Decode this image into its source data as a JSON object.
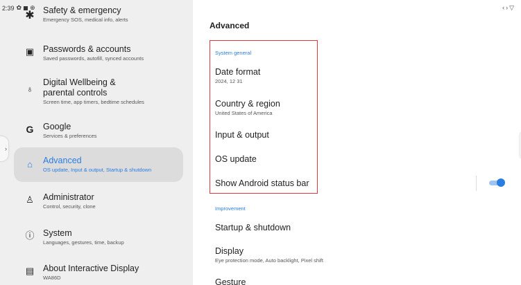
{
  "status_bar": {
    "time": "2:39"
  },
  "left_menu": {
    "items": [
      {
        "id": "safety",
        "icon": "asterisk-icon",
        "glyph": "✱",
        "title": "Safety & emergency",
        "subtitle": "Emergency SOS, medical info, alerts"
      },
      {
        "id": "passwords",
        "icon": "account-box-icon",
        "glyph": "▣",
        "title": "Passwords & accounts",
        "subtitle": "Saved passwords, autofill, synced accounts"
      },
      {
        "id": "wellbeing",
        "icon": "wellbeing-icon",
        "glyph": "♁",
        "title": "Digital Wellbeing & parental controls",
        "subtitle": "Screen time, app timers, bedtime schedules"
      },
      {
        "id": "google",
        "icon": "google-icon",
        "glyph": "G",
        "title": "Google",
        "subtitle": "Services & preferences"
      },
      {
        "id": "advanced",
        "icon": "advanced-icon",
        "glyph": "⌂",
        "title": "Advanced",
        "subtitle": "OS update, Input & output, Startup & shutdown"
      },
      {
        "id": "administrator",
        "icon": "admin-person-icon",
        "glyph": "♙",
        "title": "Administrator",
        "subtitle": "Control, security, clone"
      },
      {
        "id": "system",
        "icon": "info-icon",
        "glyph": "ⓘ",
        "title": "System",
        "subtitle": "Languages, gestures, time, backup"
      },
      {
        "id": "about",
        "icon": "device-icon",
        "glyph": "▤",
        "title": "About Interactive Display",
        "subtitle": "WA86D"
      }
    ],
    "selected": "advanced"
  },
  "detail": {
    "title": "Advanced",
    "sections": [
      {
        "label": "System general",
        "rows": [
          {
            "title": "Date format",
            "subtitle": "2024, 12 31"
          },
          {
            "title": "Country & region",
            "subtitle": "United States of America"
          },
          {
            "title": "Input & output",
            "subtitle": ""
          },
          {
            "title": "OS update",
            "subtitle": ""
          },
          {
            "title": "Show Android status bar",
            "subtitle": "",
            "toggle": true
          }
        ]
      },
      {
        "label": "Improvement",
        "rows": [
          {
            "title": "Startup & shutdown",
            "subtitle": ""
          },
          {
            "title": "Display",
            "subtitle": "Eye protection mode, Auto backlight, Pixel shift"
          },
          {
            "title": "Gesture",
            "subtitle": ""
          }
        ]
      }
    ]
  },
  "colors": {
    "accent": "#2a7de1",
    "highlight_border": "#e23a3a",
    "sidebar_bg": "#efefef",
    "selected_bg": "#dcdcdc"
  }
}
